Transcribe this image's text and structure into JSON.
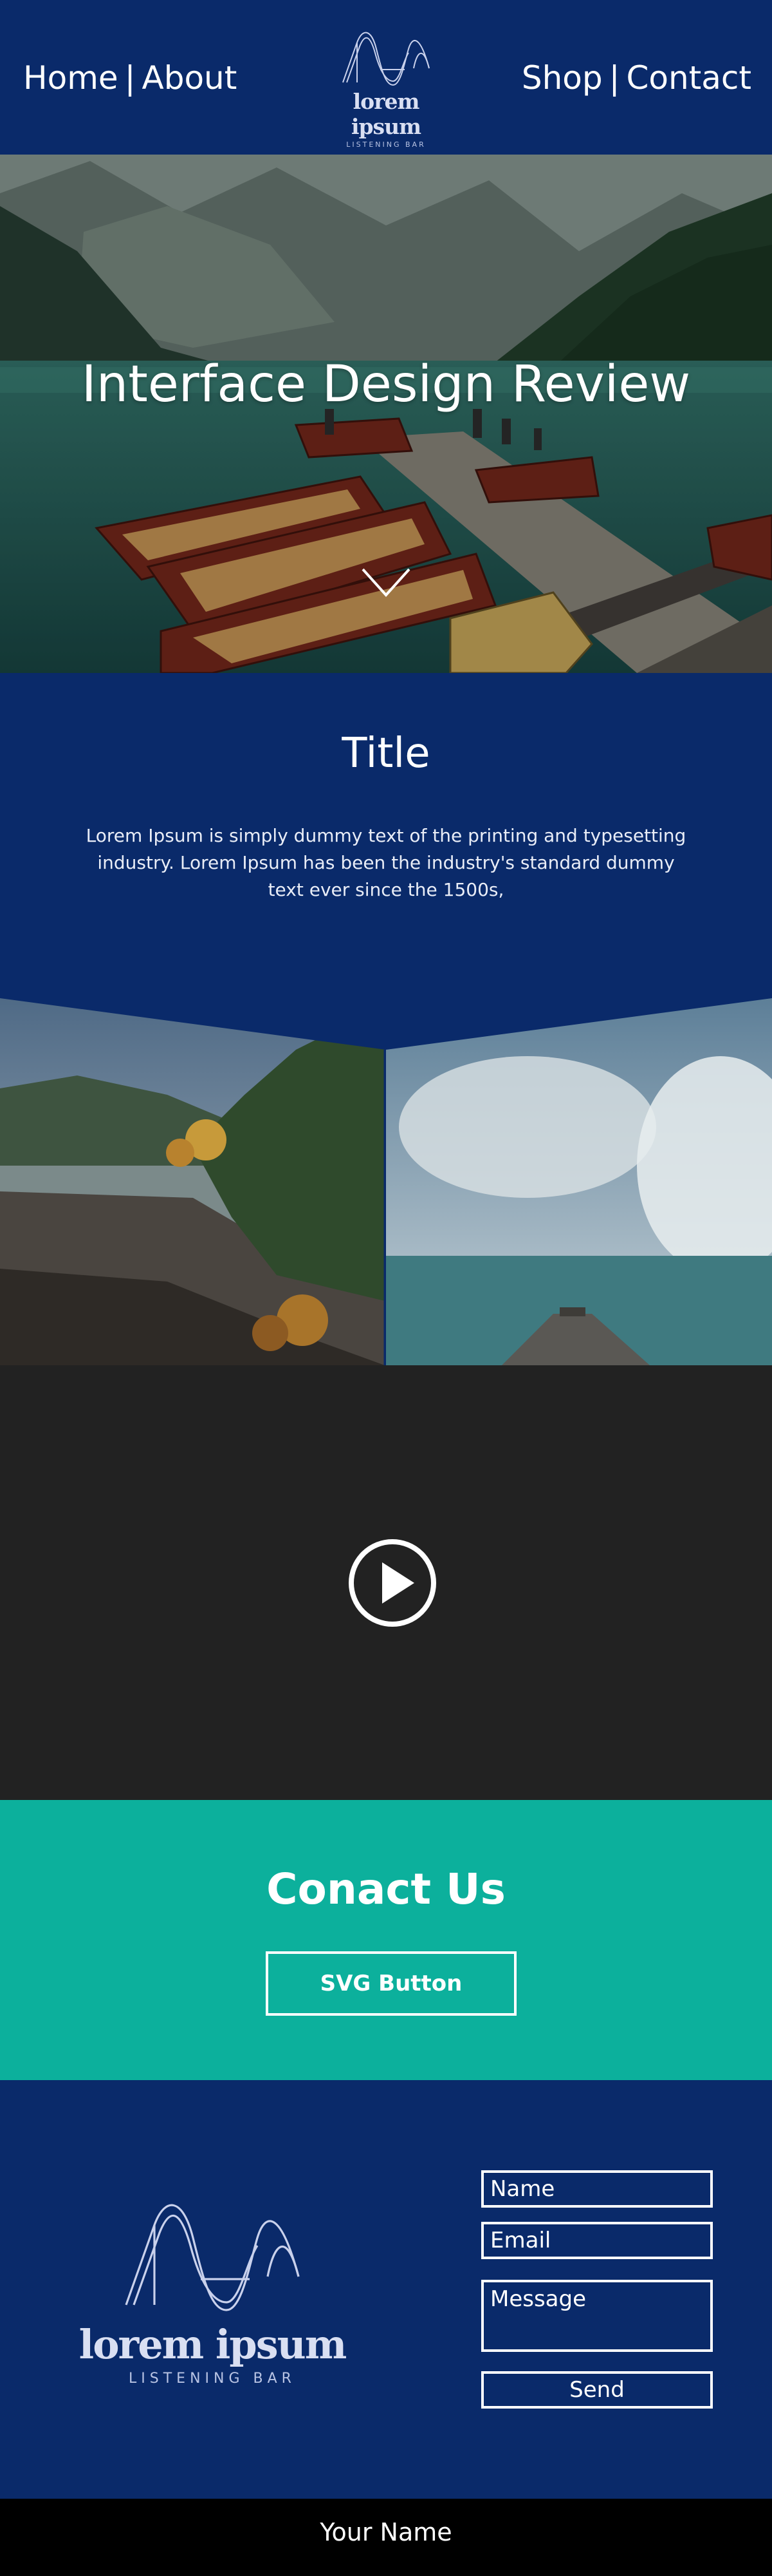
{
  "nav": {
    "left": [
      {
        "label": "Home"
      },
      {
        "label": "About"
      }
    ],
    "right": [
      {
        "label": "Shop"
      },
      {
        "label": "Contact"
      }
    ],
    "separator": "|"
  },
  "brand": {
    "name": "lorem ipsum",
    "tagline": "LISTENING BAR"
  },
  "hero": {
    "title": "Interface Design Review"
  },
  "intro": {
    "title": "Title",
    "text": "Lorem Ipsum is simply dummy text of the printing and typesetting industry. Lorem Ipsum has been the industry's standard dummy text ever since the 1500s,"
  },
  "cta": {
    "title": "Conact Us",
    "button_label": "SVG Button"
  },
  "form": {
    "name_placeholder": "Name",
    "email_placeholder": "Email",
    "message_placeholder": "Message",
    "send_label": "Send"
  },
  "footer": {
    "name": "Your Name"
  },
  "colors": {
    "navy": "#0a2a6a",
    "teal": "#0cb09c",
    "video_bg": "#222222",
    "footer_bg": "#000000"
  },
  "icons": [
    "brand-logo-icon",
    "chevron-down-icon",
    "play-icon"
  ]
}
